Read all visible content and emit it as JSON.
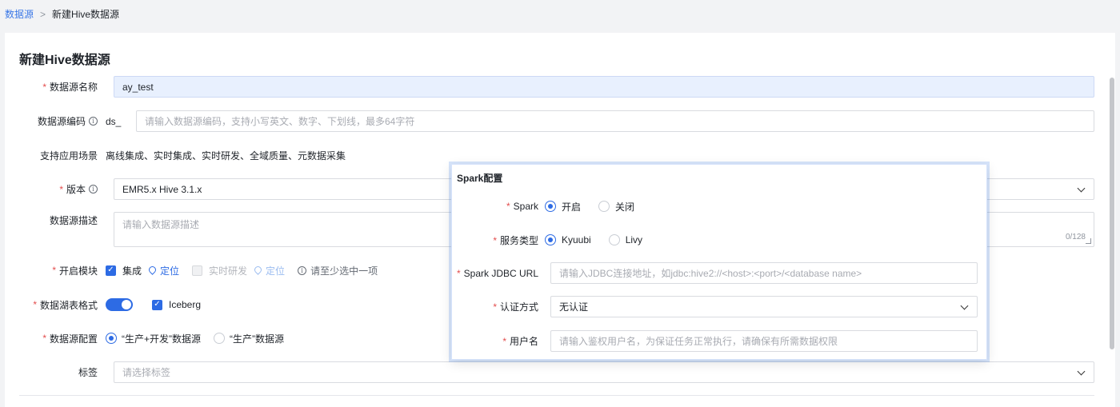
{
  "breadcrumb": {
    "root": "数据源",
    "separator": ">",
    "current": "新建Hive数据源"
  },
  "page_title": "新建Hive数据源",
  "form": {
    "name": {
      "label": "数据源名称",
      "value": "ay_test"
    },
    "code": {
      "label": "数据源编码",
      "prefix": "ds_",
      "placeholder": "请输入数据源编码，支持小写英文、数字、下划线，最多64字符"
    },
    "scenes": {
      "label": "支持应用场景",
      "value": "离线集成、实时集成、实时研发、全域质量、元数据采集"
    },
    "version": {
      "label": "版本",
      "value": "EMR5.x Hive 3.1.x"
    },
    "description": {
      "label": "数据源描述",
      "placeholder": "请输入数据源描述",
      "counter": "0/128"
    },
    "modules": {
      "label": "开启模块",
      "integration": "集成",
      "integration_locate": "定位",
      "realtime": "实时研发",
      "realtime_locate": "定位",
      "hint": "请至少选中一项"
    },
    "lake_format": {
      "label": "数据湖表格式",
      "iceberg": "Iceberg"
    },
    "config": {
      "label": "数据源配置",
      "option_dev_prod": "“生产+开发”数据源",
      "option_prod": "“生产”数据源"
    },
    "tags": {
      "label": "标签",
      "placeholder": "请选择标签"
    }
  },
  "spark_popover": {
    "title": "Spark配置",
    "spark": {
      "label": "Spark",
      "on": "开启",
      "off": "关闭"
    },
    "service_type": {
      "label": "服务类型",
      "kyuubi": "Kyuubi",
      "livy": "Livy"
    },
    "jdbc_url": {
      "label": "Spark JDBC URL",
      "placeholder": "请输入JDBC连接地址，如jdbc:hive2://<host>:<port>/<database name>"
    },
    "auth": {
      "label": "认证方式",
      "value": "无认证"
    },
    "username": {
      "label": "用户名",
      "placeholder": "请输入鉴权用户名，为保证任务正常执行，请确保有所需数据权限"
    }
  },
  "colors": {
    "accent": "#2d6be4",
    "required": "#e34d4d",
    "link": "#3b78e7"
  },
  "icons": [
    "info-icon",
    "chevron-down-icon",
    "location-pin-icon",
    "checkbox-checked-icon"
  ]
}
